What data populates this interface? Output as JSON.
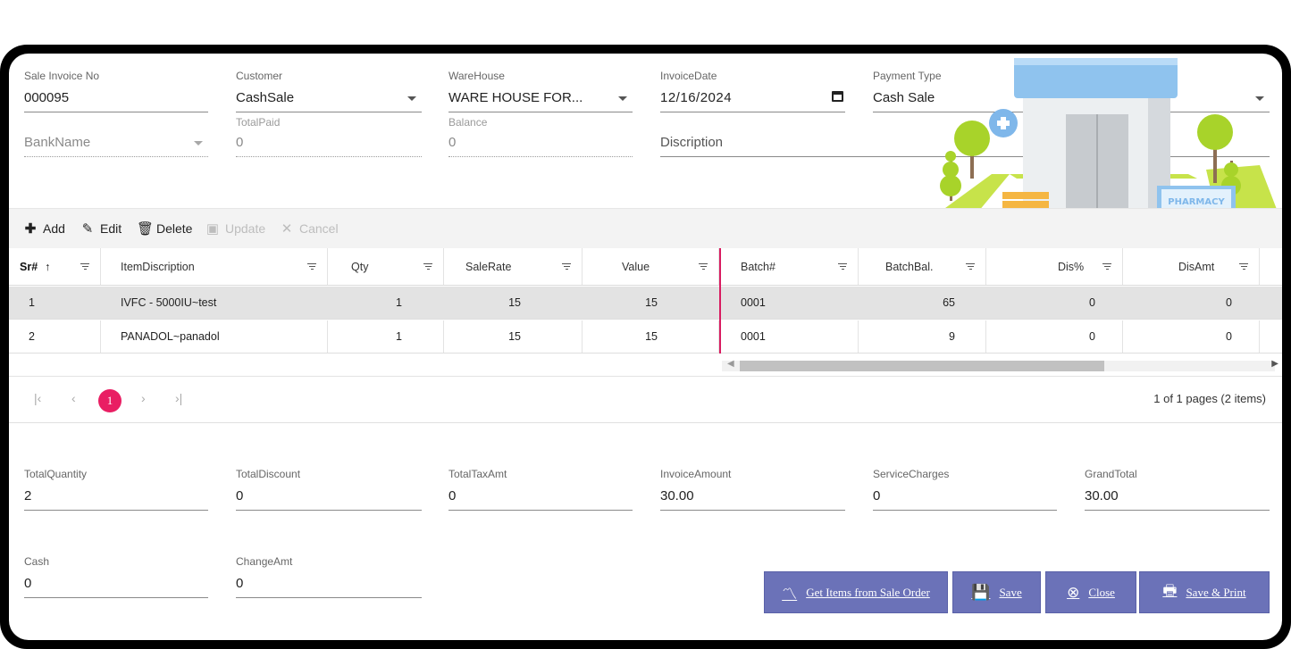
{
  "header_fields": {
    "invoice_no": {
      "label": "Sale Invoice No",
      "value": "000095"
    },
    "customer": {
      "label": "Customer",
      "value": "CashSale"
    },
    "warehouse": {
      "label": "WareHouse",
      "value": "WARE HOUSE FOR..."
    },
    "invoice_date": {
      "label": "InvoiceDate",
      "value": "12/16/2024"
    },
    "payment_type": {
      "label": "Payment Type",
      "value": "Cash Sale"
    },
    "bank_name": {
      "placeholder": "BankName"
    },
    "total_paid": {
      "label": "TotalPaid",
      "value": "0"
    },
    "balance": {
      "label": "Balance",
      "value": "0"
    },
    "description": {
      "placeholder": "Discription"
    }
  },
  "toolbar": {
    "add": "Add",
    "edit": "Edit",
    "delete": "Delete",
    "update": "Update",
    "cancel": "Cancel"
  },
  "grid": {
    "columns": [
      "Sr#",
      "ItemDiscription",
      "Qty",
      "SaleRate",
      "Value",
      "Batch#",
      "BatchBal.",
      "Dis%",
      "DisAmt"
    ],
    "rows": [
      [
        "1",
        "IVFC - 5000IU~test",
        "1",
        "15",
        "15",
        "0001",
        "65",
        "0",
        "0"
      ],
      [
        "2",
        "PANADOL~panadol",
        "1",
        "15",
        "15",
        "0001",
        "9",
        "0",
        "0"
      ]
    ]
  },
  "pager": {
    "current_page": "1",
    "info": "1 of 1 pages (2 items)"
  },
  "totals": {
    "total_quantity": {
      "label": "TotalQuantity",
      "value": "2"
    },
    "total_discount": {
      "label": "TotalDiscount",
      "value": "0"
    },
    "total_tax_amt": {
      "label": "TotalTaxAmt",
      "value": "0"
    },
    "invoice_amount": {
      "label": "InvoiceAmount",
      "value": "30.00"
    },
    "service_charges": {
      "label": "ServiceCharges",
      "value": "0"
    },
    "grand_total": {
      "label": "GrandTotal",
      "value": "30.00"
    },
    "cash": {
      "label": "Cash",
      "value": "0"
    },
    "change_amt": {
      "label": "ChangeAmt",
      "value": "0"
    }
  },
  "buttons": {
    "get_items": "Get Items from Sale Order",
    "save": "Save",
    "close": "Close",
    "save_print": "Save & Print"
  },
  "illustration": {
    "sign_text": "PHARMACY"
  },
  "colors": {
    "accent_pink": "#e91e63",
    "button_bg": "#6b72b8"
  }
}
